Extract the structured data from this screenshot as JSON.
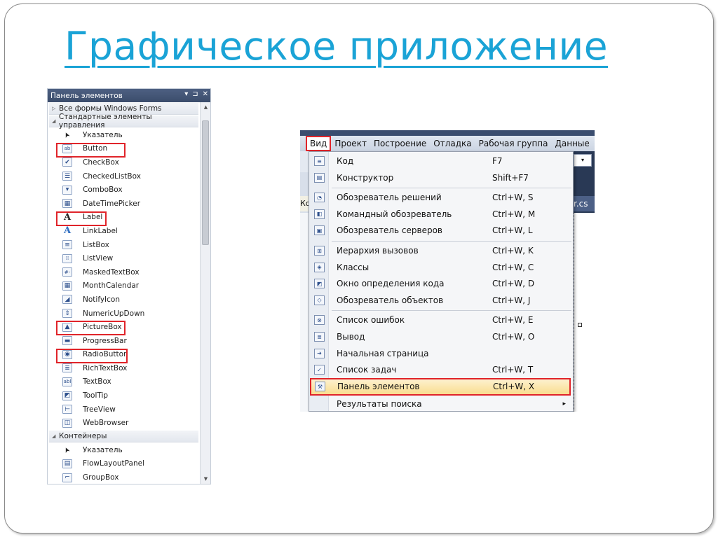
{
  "slide": {
    "title": "Графическое приложение"
  },
  "toolbox": {
    "header": "Панель элементов",
    "header_buttons": [
      "▾",
      "⊐",
      "✕"
    ],
    "groups": {
      "all_forms": "Все формы Windows Forms",
      "standard": "Стандартные элементы управления",
      "containers": "Контейнеры"
    },
    "standard_items": [
      {
        "label": "Указатель",
        "icon": "pointer-icon"
      },
      {
        "label": "Button",
        "icon": "button-icon",
        "glyph": "ab",
        "highlight": true
      },
      {
        "label": "CheckBox",
        "icon": "checkbox-icon",
        "glyph": "✔"
      },
      {
        "label": "CheckedListBox",
        "icon": "checkedlistbox-icon",
        "glyph": "☰"
      },
      {
        "label": "ComboBox",
        "icon": "combobox-icon",
        "glyph": "▾"
      },
      {
        "label": "DateTimePicker",
        "icon": "datetimepicker-icon",
        "glyph": "▦"
      },
      {
        "label": "Label",
        "icon": "label-icon",
        "glyph": "A",
        "highlight": true
      },
      {
        "label": "LinkLabel",
        "icon": "linklabel-icon",
        "glyph": "A"
      },
      {
        "label": "ListBox",
        "icon": "listbox-icon",
        "glyph": "≡"
      },
      {
        "label": "ListView",
        "icon": "listview-icon",
        "glyph": "⁞⁞"
      },
      {
        "label": "MaskedTextBox",
        "icon": "maskedtextbox-icon",
        "glyph": "#-"
      },
      {
        "label": "MonthCalendar",
        "icon": "monthcalendar-icon",
        "glyph": "▦"
      },
      {
        "label": "NotifyIcon",
        "icon": "notifyicon-icon",
        "glyph": "◢"
      },
      {
        "label": "NumericUpDown",
        "icon": "numericupdown-icon",
        "glyph": "⇕"
      },
      {
        "label": "PictureBox",
        "icon": "picturebox-icon",
        "glyph": "▲",
        "highlight": true
      },
      {
        "label": "ProgressBar",
        "icon": "progressbar-icon",
        "glyph": "▬"
      },
      {
        "label": "RadioButton",
        "icon": "radiobutton-icon",
        "glyph": "◉",
        "highlight": true
      },
      {
        "label": "RichTextBox",
        "icon": "richtextbox-icon",
        "glyph": "≣"
      },
      {
        "label": "TextBox",
        "icon": "textbox-icon",
        "glyph": "abl"
      },
      {
        "label": "ToolTip",
        "icon": "tooltip-icon",
        "glyph": "◩"
      },
      {
        "label": "TreeView",
        "icon": "treeview-icon",
        "glyph": "⊢"
      },
      {
        "label": "WebBrowser",
        "icon": "webbrowser-icon",
        "glyph": "◫"
      }
    ],
    "container_items": [
      {
        "label": "Указатель",
        "icon": "pointer-icon"
      },
      {
        "label": "FlowLayoutPanel",
        "icon": "flowlayoutpanel-icon",
        "glyph": "▤"
      },
      {
        "label": "GroupBox",
        "icon": "groupbox-icon",
        "glyph": "⌐"
      }
    ]
  },
  "vs": {
    "menubar": [
      "Вид",
      "Проект",
      "Построение",
      "Отладка",
      "Рабочая группа",
      "Данные"
    ],
    "tab_left": "Ко",
    "tab_right": "r.cs",
    "menu_items": [
      {
        "label": "Код",
        "shortcut": "F7",
        "glyph": "≡"
      },
      {
        "label": "Конструктор",
        "shortcut": "Shift+F7",
        "glyph": "▤"
      },
      {
        "sep": true
      },
      {
        "label": "Обозреватель решений",
        "shortcut": "Ctrl+W, S",
        "glyph": "◔"
      },
      {
        "label": "Командный обозреватель",
        "shortcut": "Ctrl+W, M",
        "glyph": "◧"
      },
      {
        "label": "Обозреватель серверов",
        "shortcut": "Ctrl+W, L",
        "glyph": "▣"
      },
      {
        "sep": true
      },
      {
        "label": "Иерархия вызовов",
        "shortcut": "Ctrl+W, K",
        "glyph": "⊞"
      },
      {
        "label": "Классы",
        "shortcut": "Ctrl+W, C",
        "glyph": "◈"
      },
      {
        "label": "Окно определения кода",
        "shortcut": "Ctrl+W, D",
        "glyph": "◩"
      },
      {
        "label": "Обозреватель объектов",
        "shortcut": "Ctrl+W, J",
        "glyph": "◇"
      },
      {
        "sep": true
      },
      {
        "label": "Список ошибок",
        "shortcut": "Ctrl+W, E",
        "glyph": "⊗"
      },
      {
        "label": "Вывод",
        "shortcut": "Ctrl+W, O",
        "glyph": "≣"
      },
      {
        "label": "Начальная страница",
        "shortcut": "",
        "glyph": "➜"
      },
      {
        "label": "Список задач",
        "shortcut": "Ctrl+W, T",
        "glyph": "✓"
      },
      {
        "label": "Панель элементов",
        "shortcut": "Ctrl+W, X",
        "glyph": "⚒",
        "selected": true
      },
      {
        "label": "Результаты поиска",
        "shortcut": "",
        "glyph": "",
        "submenu": "▸"
      }
    ]
  },
  "colors": {
    "title": "#1aa3d6",
    "highlight_border": "#e0242a",
    "vs_dark": "#293955"
  }
}
